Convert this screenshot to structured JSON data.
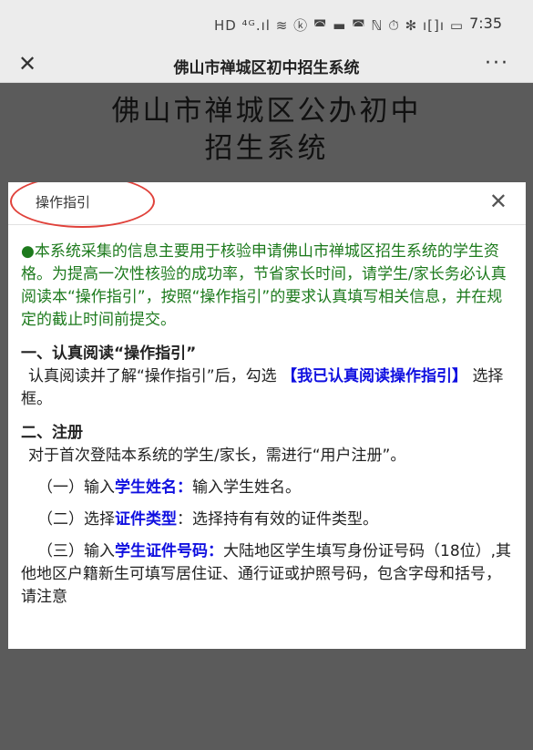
{
  "status_bar": {
    "icons": "HD ⁴ᴳ.ıl ≋ ⓚ ◚ ▬ ◚  ℕ ⏱ ✻ ı[]ı ▭",
    "time": "7:35"
  },
  "nav": {
    "close_symbol": "✕",
    "title": "佛山市禅城区初中招生系统",
    "more_symbol": "···"
  },
  "page": {
    "title_line1": "佛山市禅城区公办初中",
    "title_line2": "招生系统"
  },
  "modal": {
    "title": "操作指引",
    "close_symbol": "✕",
    "intro": "●本系统采集的信息主要用于核验申请佛山市禅城区招生系统的学生资格。为提高一次性核验的成功率，节省家长时间，请学生/家长务必认真阅读本“操作指引”，按照“操作指引”的要求认真填写相关信息，并在规定的截止时间前提交。",
    "section1_heading": "一、认真阅读“操作指引”",
    "section1_text": "认真阅读并了解“操作指引”后，勾选",
    "section1_highlight": "【我已认真阅读操作指引】",
    "section1_suffix": "选择框。",
    "section2_heading": "二、注册",
    "section2_text": "对于首次登陆本系统的学生/家长，需进行“用户注册”。",
    "item1_prefix": "（一）输入",
    "item1_highlight": "学生姓名：",
    "item1_text": "输入学生姓名。",
    "item2_prefix": "（二）选择",
    "item2_highlight": "证件类型",
    "item2_text": "：选择持有有效的证件类型。",
    "item3_prefix": "（三）输入",
    "item3_highlight": "学生证件号码：",
    "item3_text": "大陆地区学生填写身份证号码（18位）,其他地区户籍新生可填写居住证、通行证或护照号码，包含字母和括号，请注意"
  }
}
